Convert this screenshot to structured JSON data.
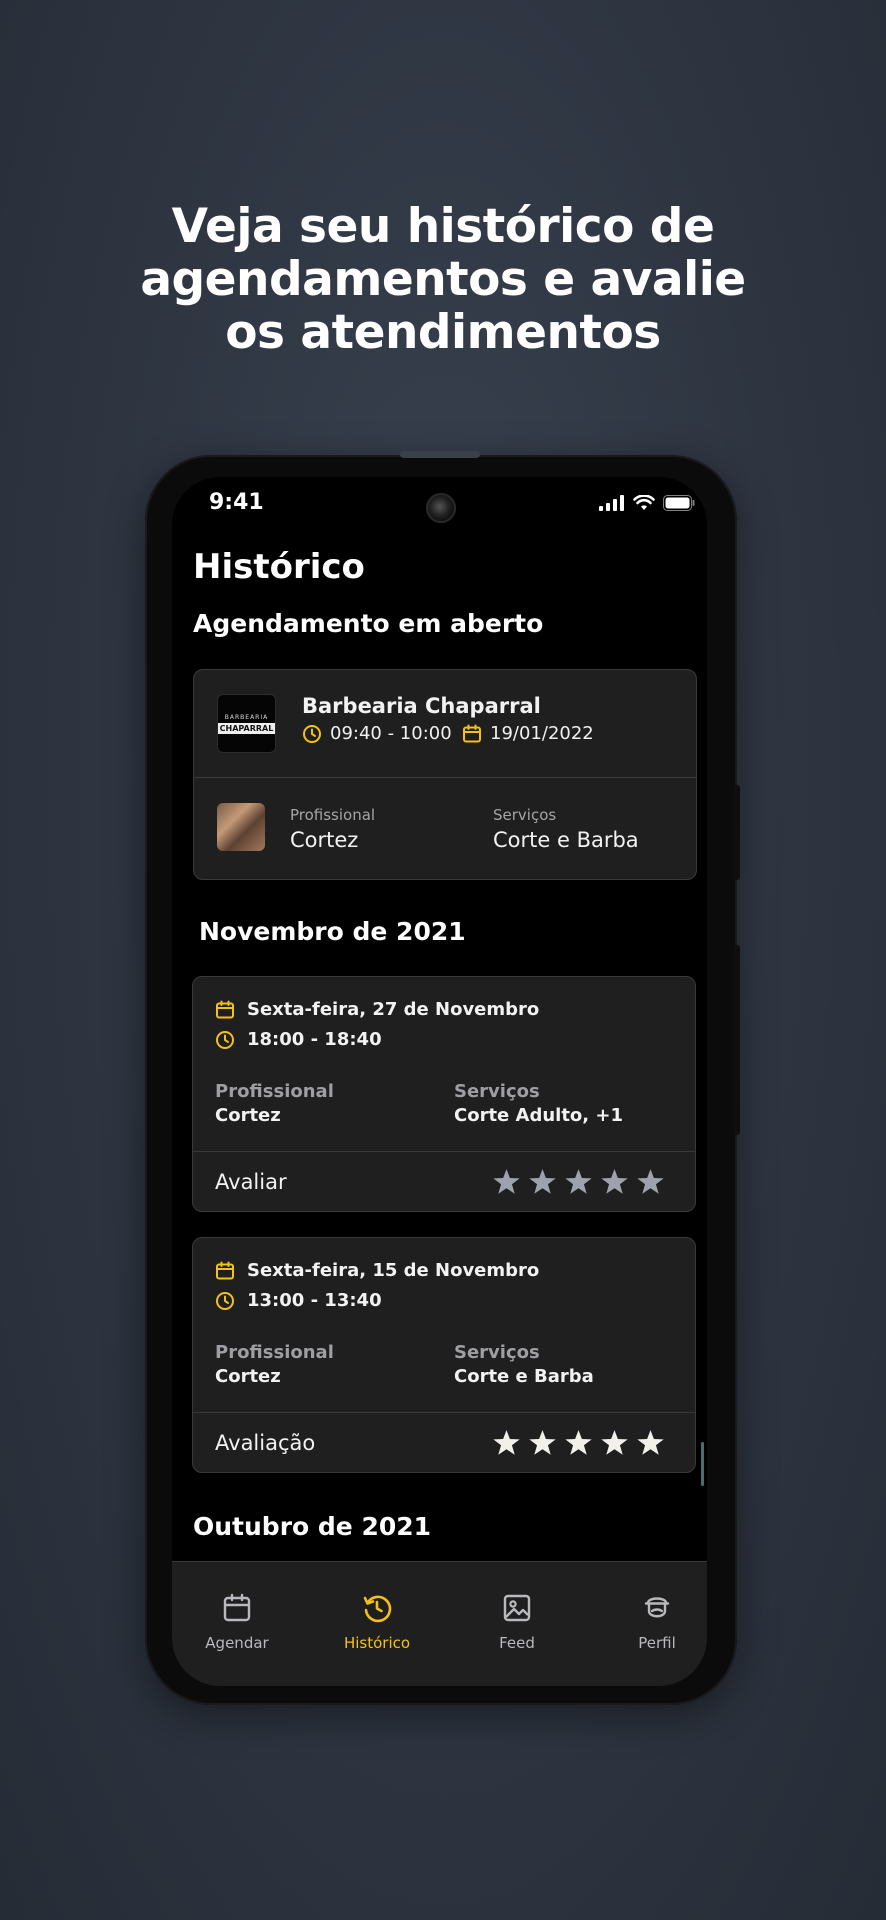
{
  "headline": {
    "line1": "Veja seu histórico de",
    "line2": "agendamentos e avalie",
    "line3": "os atendimentos"
  },
  "status_bar": {
    "time": "9:41"
  },
  "page": {
    "title": "Histórico"
  },
  "open_section": {
    "title": "Agendamento em aberto",
    "card": {
      "logo_top": "BARBEARIA",
      "logo_main": "CHAPARRAL",
      "shop_name": "Barbearia Chaparral",
      "time": "09:40 - 10:00",
      "date": "19/01/2022",
      "professional_label": "Profissional",
      "professional": "Cortez",
      "services_label": "Serviços",
      "services": "Corte e Barba"
    }
  },
  "months": [
    {
      "title": "Novembro de 2021",
      "appointments": [
        {
          "date": "Sexta-feira, 27 de Novembro",
          "time": "18:00 - 18:40",
          "professional_label": "Profissional",
          "professional": "Cortez",
          "services_label": "Serviços",
          "services": "Corte Adulto, +1",
          "rating_label": "Avaliar",
          "rating": 0
        },
        {
          "date": "Sexta-feira, 15 de Novembro",
          "time": "13:00 - 13:40",
          "professional_label": "Profissional",
          "professional": "Cortez",
          "services_label": "Serviços",
          "services": "Corte e Barba",
          "rating_label": "Avaliação",
          "rating": 5
        }
      ]
    },
    {
      "title": "Outubro de 2021"
    }
  ],
  "nav": {
    "items": [
      {
        "label": "Agendar",
        "icon": "calendar-icon",
        "active": false
      },
      {
        "label": "Histórico",
        "icon": "history-icon",
        "active": true
      },
      {
        "label": "Feed",
        "icon": "image-icon",
        "active": false
      },
      {
        "label": "Perfil",
        "icon": "profile-icon",
        "active": false
      }
    ]
  },
  "colors": {
    "accent": "#F3C117",
    "star_filled": "#F2F0EA",
    "star_empty": "#9DA2AC",
    "card_bg": "#1F1F20"
  }
}
